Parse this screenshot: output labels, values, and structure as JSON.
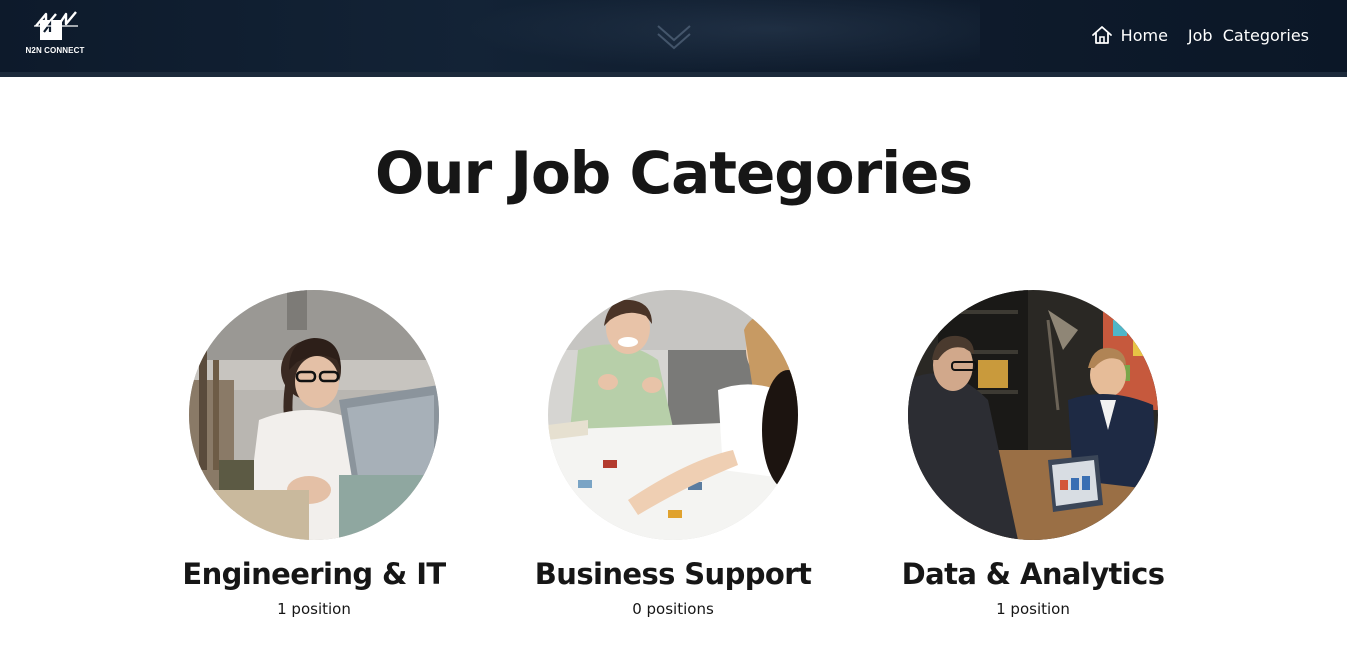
{
  "header": {
    "logo_text": "N2N CONNECT",
    "nav": [
      {
        "label": "Home",
        "icon": "home-icon"
      },
      {
        "label": "Job  Categories"
      }
    ],
    "background_color": "#0d1a2b"
  },
  "main": {
    "title": "Our Job Categories",
    "categories": [
      {
        "name": "Engineering & IT",
        "count": "1 position"
      },
      {
        "name": "Business Support",
        "count": "0 positions"
      },
      {
        "name": "Data & Analytics",
        "count": "1 position"
      }
    ]
  }
}
